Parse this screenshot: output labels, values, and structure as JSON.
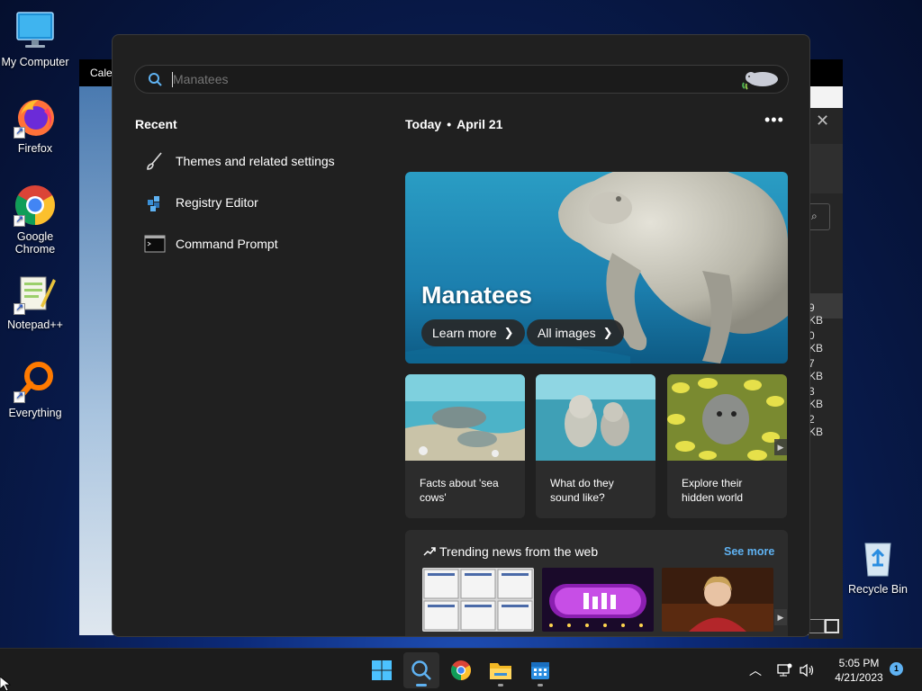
{
  "desktop": {
    "icons": [
      {
        "label": "My Computer",
        "icon": "monitor-icon"
      },
      {
        "label": "Firefox",
        "icon": "firefox-icon"
      },
      {
        "label": "Google Chrome",
        "icon": "chrome-icon"
      },
      {
        "label": "Notepad++",
        "icon": "notepadpp-icon"
      },
      {
        "label": "Everything",
        "icon": "everything-icon"
      },
      {
        "label": "Recycle Bin",
        "icon": "recycle-bin-icon"
      }
    ]
  },
  "background_window": {
    "title_fragment": "Calen",
    "sizes": [
      "9 KB",
      "0 KB",
      "7 KB",
      "3 KB",
      "2 KB"
    ]
  },
  "search": {
    "placeholder": "Manatees",
    "recent_title": "Recent",
    "recent_items": [
      {
        "label": "Themes and related settings",
        "icon": "paintbrush-icon"
      },
      {
        "label": "Registry Editor",
        "icon": "registry-editor-icon"
      },
      {
        "label": "Command Prompt",
        "icon": "command-prompt-icon"
      }
    ],
    "today_label": "Today",
    "date_label": "April 21",
    "hero": {
      "title": "Manatees",
      "learn_more": "Learn more",
      "all_images": "All images"
    },
    "cards": [
      {
        "text": "Facts about 'sea cows'"
      },
      {
        "text": "What do they sound like?"
      },
      {
        "text": "Explore their hidden world"
      }
    ],
    "trending": {
      "title": "Trending news from the web",
      "see_more": "See more"
    }
  },
  "taskbar": {
    "time": "5:05 PM",
    "date": "4/21/2023",
    "notifications": "1"
  },
  "colors": {
    "accent": "#5fb2f2",
    "flyout_bg": "#202020",
    "card_bg": "#2c2c2c"
  }
}
